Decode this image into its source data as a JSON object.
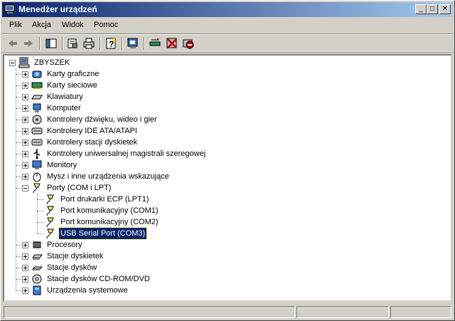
{
  "window": {
    "title": "Menedżer urządzeń"
  },
  "menubar": {
    "items": [
      "Plik",
      "Akcja",
      "Widok",
      "Pomoc"
    ]
  },
  "toolbar": {
    "icons": [
      "back-icon",
      "forward-icon",
      "show-hide-tree-icon",
      "properties-icon",
      "print-icon",
      "help-icon",
      "scan-hardware-icon",
      "update-driver-icon",
      "disable-device-icon",
      "uninstall-device-icon"
    ]
  },
  "tree": {
    "root": "ZBYSZEK",
    "nodes": [
      {
        "label": "Karty graficzne",
        "icon": "display-adapter-icon",
        "expanded": false
      },
      {
        "label": "Karty sieciowe",
        "icon": "network-card-icon",
        "expanded": false
      },
      {
        "label": "Klawiatury",
        "icon": "keyboard-icon",
        "expanded": false
      },
      {
        "label": "Komputer",
        "icon": "computer-icon",
        "expanded": false
      },
      {
        "label": "Kontrolery dźwięku, wideo i gier",
        "icon": "sound-icon",
        "expanded": false
      },
      {
        "label": "Kontrolery IDE ATA/ATAPI",
        "icon": "ide-controller-icon",
        "expanded": false
      },
      {
        "label": "Kontrolery stacji dyskietek",
        "icon": "floppy-controller-icon",
        "expanded": false
      },
      {
        "label": "Kontrolery uniwersalnej magistrali szeregowej",
        "icon": "usb-icon",
        "expanded": false
      },
      {
        "label": "Monitory",
        "icon": "monitor-icon",
        "expanded": false
      },
      {
        "label": "Mysz i inne urządzenia wskazujące",
        "icon": "mouse-icon",
        "expanded": false
      },
      {
        "label": "Porty (COM i LPT)",
        "icon": "port-icon",
        "expanded": true,
        "children": [
          {
            "label": "Port drukarki ECP (LPT1)",
            "selected": false
          },
          {
            "label": "Port komunikacyjny (COM1)",
            "selected": false
          },
          {
            "label": "Port komunikacyjny (COM2)",
            "selected": false
          },
          {
            "label": "USB Serial Port (COM3)",
            "selected": true
          }
        ]
      },
      {
        "label": "Procesory",
        "icon": "processor-icon",
        "expanded": false
      },
      {
        "label": "Stacje dyskietek",
        "icon": "floppy-drive-icon",
        "expanded": false
      },
      {
        "label": "Stacje dysków",
        "icon": "disk-drive-icon",
        "expanded": false
      },
      {
        "label": "Stacje dysków CD-ROM/DVD",
        "icon": "cdrom-icon",
        "expanded": false
      },
      {
        "label": "Urządzenia systemowe",
        "icon": "system-devices-icon",
        "expanded": false
      }
    ]
  },
  "colors": {
    "titlebar_start": "#0a246a",
    "titlebar_end": "#a6caf0",
    "selection": "#0a246a",
    "face": "#d4d0c8"
  }
}
